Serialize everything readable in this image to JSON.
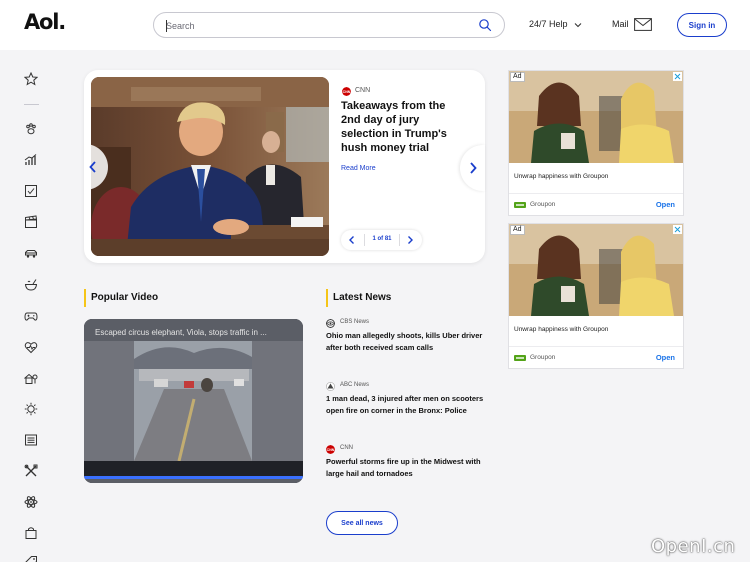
{
  "header": {
    "logo": "Aol.",
    "search_placeholder": "Search",
    "help_label": "24/7 Help",
    "mail_label": "Mail",
    "signin_label": "Sign in"
  },
  "sidebar": {
    "icons": [
      "star-icon",
      "paw-icon",
      "chart-icon",
      "checkbox-icon",
      "clapper-icon",
      "car-icon",
      "bowl-icon",
      "gamepad-icon",
      "heart-pulse-icon",
      "house-tree-icon",
      "gear-sun-icon",
      "newspaper-icon",
      "tools-icon",
      "atom-icon",
      "shopping-bag-icon",
      "tag-icon"
    ]
  },
  "hero": {
    "source": "CNN",
    "title": "Takeaways from the 2nd day of jury selection in Trump's hush money trial",
    "read_more": "Read More",
    "counter": "1 of 81"
  },
  "popular_video": {
    "heading": "Popular Video",
    "title": "Escaped circus elephant, Viola, stops traffic in ...",
    "progress": 1.0
  },
  "latest_news": {
    "heading": "Latest News",
    "items": [
      {
        "source": "CBS News",
        "title": "Ohio man allegedly shoots, kills Uber driver after both received scam calls"
      },
      {
        "source": "ABC News",
        "title": "1 man dead, 3 injured after men on scooters open fire on corner in the Bronx: Police"
      },
      {
        "source": "CNN",
        "title": "Powerful storms fire up in the Midwest with large hail and tornadoes"
      }
    ],
    "see_all": "See all news"
  },
  "ads": [
    {
      "label": "Ad",
      "text": "Unwrap happiness with Groupon",
      "brand": "Groupon",
      "cta": "Open"
    },
    {
      "label": "Ad",
      "text": "Unwrap happiness with Groupon",
      "brand": "Groupon",
      "cta": "Open"
    }
  ],
  "watermark": "OpenI.cn",
  "colors": {
    "accent": "#1a3ecc",
    "highlight": "#f5c518",
    "cnn": "#cc0000",
    "groupon": "#53a318",
    "ad_cta": "#1a73e8"
  }
}
